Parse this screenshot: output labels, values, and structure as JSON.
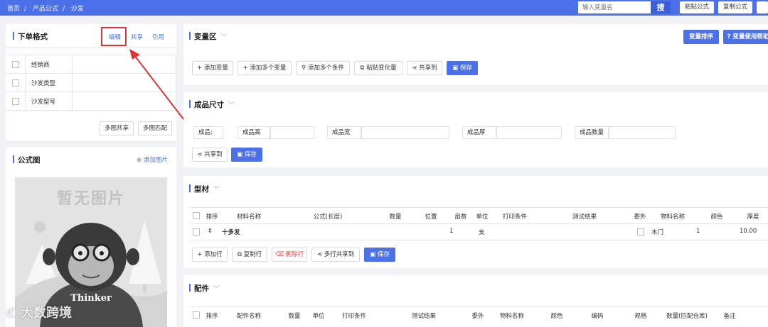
{
  "breadcrumb": [
    "首页",
    "产品公式",
    "沙发"
  ],
  "search": {
    "placeholder": "输入变量名",
    "button": "搜"
  },
  "toolbar": {
    "paste_formula": "粘贴公式",
    "copy_formula": "复制公式"
  },
  "order_format": {
    "title": "下单格式",
    "edit": "编辑",
    "share": "共享",
    "reference": "引用",
    "items": [
      "经销商",
      "沙发类型",
      "沙发型号"
    ],
    "multi_share": "多图共享",
    "multi_match": "多图匹配"
  },
  "formula_image": {
    "title": "公式图",
    "add_image": "添加图片",
    "placeholder_text": "暂无图片",
    "shirt_text": "Thinker"
  },
  "variable_area": {
    "title": "变量区",
    "sort_button": "变量排序",
    "help_button": "? 变量使用帮助",
    "buttons": [
      "添加变量",
      "添加多个变量",
      "添加多个条件",
      "粘贴变化量",
      "共享到",
      "保存"
    ]
  },
  "product_size": {
    "title": "成品尺寸",
    "fields": [
      "成品:",
      "成品高",
      "成品宽",
      "成品厚",
      "成品数量"
    ],
    "share_to": "共享到",
    "save": "保存"
  },
  "profile": {
    "title": "型材",
    "headers": [
      "排序",
      "材料名称",
      "公式(长度)",
      "数量",
      "位置",
      "扇数",
      "单位",
      "打印条件",
      "测试结果",
      "委外",
      "物料名称",
      "颜色",
      "厚度"
    ],
    "row": {
      "sort": "⇕",
      "material": "十多发",
      "fans": "1",
      "unit": "支",
      "item_name": "木门",
      "color": "1",
      "thickness": "10.00"
    },
    "buttons": [
      "添加行",
      "复制行",
      "删除行",
      "多行共享到",
      "保存"
    ]
  },
  "accessories": {
    "title": "配件",
    "headers": [
      "排序",
      "配件名称",
      "数量",
      "单位",
      "打印条件",
      "测试结果",
      "委外",
      "物料名称",
      "颜色",
      "编码",
      "规格",
      "数量(匹配仓库)",
      "备注"
    ]
  },
  "watermark": "大数跨境",
  "colors": {
    "accent": "#4c70e8",
    "annotation": "#e03434",
    "danger": "#e04848"
  }
}
